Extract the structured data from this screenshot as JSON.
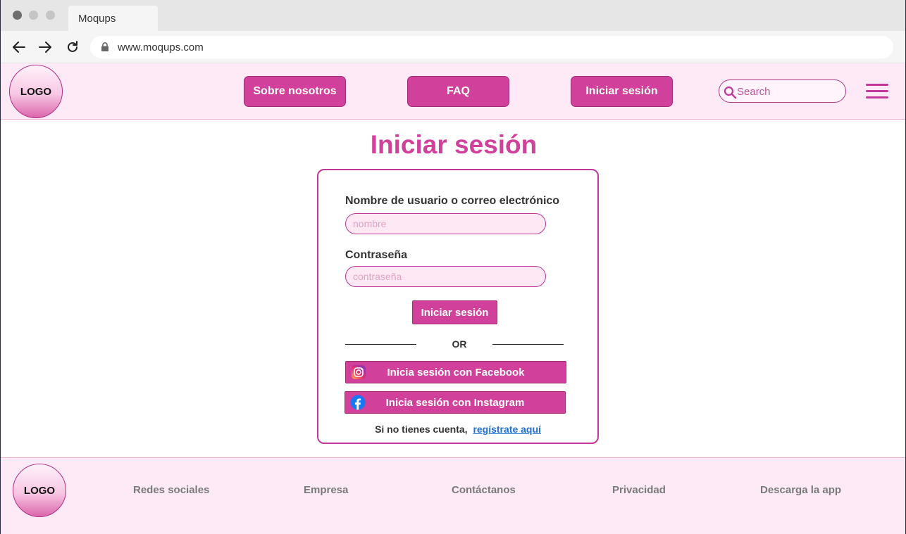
{
  "browser": {
    "tab_title": "Moqups",
    "url": "www.moqups.com"
  },
  "header": {
    "logo": "LOGO",
    "nav": [
      "Sobre nosotros",
      "FAQ",
      "Iniciar sesión"
    ],
    "search_placeholder": "Search"
  },
  "login": {
    "title": "Iniciar sesión",
    "username_label": "Nombre de usuario o correo electrónico",
    "username_placeholder": "nombre",
    "password_label": "Contraseña",
    "password_placeholder": "contraseña",
    "submit_label": "Iniciar sesión",
    "or_text": "OR",
    "facebook_button": "Inicia sesión con Facebook",
    "instagram_button": "Inicia sesión con Instagram",
    "signup_prompt": "Si no tienes cuenta,",
    "signup_link": "regístrate aquí"
  },
  "footer": {
    "logo": "LOGO",
    "links": [
      "Redes sociales",
      "Empresa",
      "Contáctanos",
      "Privacidad",
      "Descarga la app"
    ]
  },
  "colors": {
    "brand": "#d1409a",
    "header_bg": "#fdeaf6",
    "link": "#1f6fd1"
  }
}
